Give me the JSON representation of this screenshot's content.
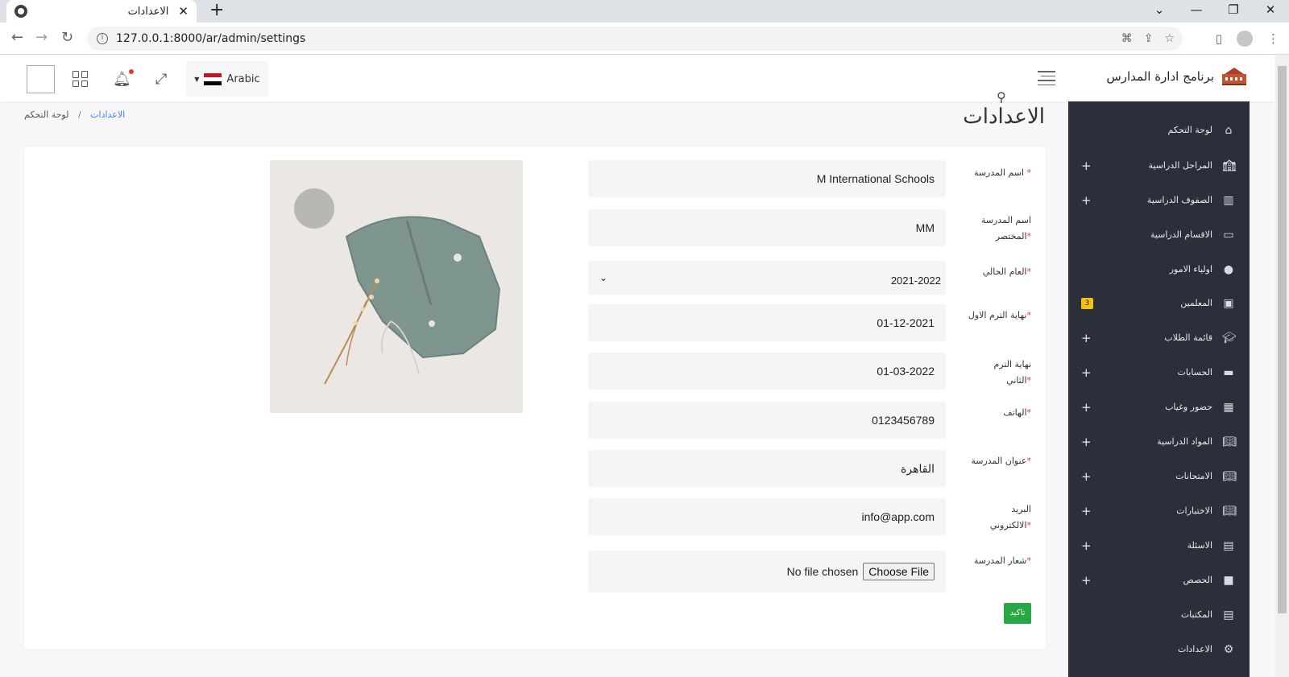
{
  "browser": {
    "tab_title": "الاعدادات",
    "url": "127.0.0.1:8000/ar/admin/settings"
  },
  "header": {
    "brand": "برنامج ادارة المدارس",
    "language": "Arabic"
  },
  "page": {
    "title": "الاعدادات",
    "breadcrumb": [
      "لوحة التحكم",
      "الاعدادات"
    ]
  },
  "form": {
    "school_name_label": "اسم المدرسة",
    "school_name": "M International Schools",
    "short_name_label_1": "اسم المدرسة",
    "short_name_label_2": "المختصر",
    "short_name": "MM",
    "current_year_label": "العام الحالي",
    "current_year": "2021-2022",
    "term1_end_label": "نهاية الترم الاول",
    "term1_end": "01-12-2021",
    "term2_end_label": "نهاية الترم الثاني",
    "term2_end": "01-03-2022",
    "phone_label": "الهاتف",
    "phone": "0123456789",
    "address_label": "عنوان المدرسة",
    "address": "القاهرة",
    "email_label_1": "البريد",
    "email_label_2": "الالكتروني",
    "email": "info@app.com",
    "logo_label": "شعار المدرسة",
    "file_status": "No file chosen",
    "choose_file": "Choose File",
    "submit": "تاكيد",
    "required_mark": "*"
  },
  "sidebar": {
    "items": [
      {
        "label": "لوحة التحكم",
        "icon": "home-icon",
        "expand": false
      },
      {
        "label": "المراحل الدراسية",
        "icon": "school-icon",
        "expand": true
      },
      {
        "label": "الصفوف الدراسية",
        "icon": "building-icon",
        "expand": true
      },
      {
        "label": "الاقسام الدراسية",
        "icon": "monitor-icon",
        "expand": false
      },
      {
        "label": "اولياء الامور",
        "icon": "user-icon",
        "expand": false
      },
      {
        "label": "المعلمين",
        "icon": "teacher-icon",
        "expand": false,
        "badge": "3"
      },
      {
        "label": "قائمة الطلاب",
        "icon": "graduate-icon",
        "expand": true
      },
      {
        "label": "الحسابات",
        "icon": "money-icon",
        "expand": true
      },
      {
        "label": "حضور وغياب",
        "icon": "calendar-icon",
        "expand": true
      },
      {
        "label": "المواد الدراسية",
        "icon": "book-open-icon",
        "expand": true
      },
      {
        "label": "الامتحانات",
        "icon": "book-open-icon",
        "expand": true
      },
      {
        "label": "الاختبارات",
        "icon": "book-open-icon",
        "expand": true
      },
      {
        "label": "الاسئلة",
        "icon": "book-icon",
        "expand": true
      },
      {
        "label": "الحصص",
        "icon": "video-icon",
        "expand": true
      },
      {
        "label": "المكتبات",
        "icon": "book-icon",
        "expand": false
      },
      {
        "label": "الاعدادات",
        "icon": "gears-icon",
        "expand": false
      }
    ]
  },
  "colors": {
    "sidebar_bg": "#2b2f3a",
    "submit_green": "#28a745",
    "badge_yellow": "#f6c20e",
    "link_blue": "#3b82f6"
  }
}
